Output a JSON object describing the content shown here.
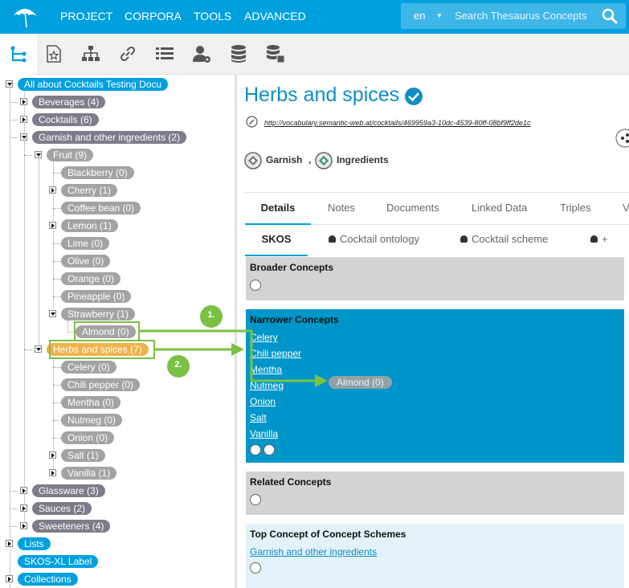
{
  "nav": {
    "menu": [
      "PROJECT",
      "CORPORA",
      "TOOLS",
      "ADVANCED"
    ],
    "lang": "en",
    "search_placeholder": "Search Thesaurus Concepts"
  },
  "toolbar": {
    "icons": [
      "hierarchy-tree-icon",
      "star-document-icon",
      "org-chart-icon",
      "link-icon",
      "list-icon",
      "user-settings-icon",
      "database-icon",
      "database-server-icon"
    ]
  },
  "tree": {
    "root": "All about Cocktails Testing Docu",
    "beverages": "Beverages (4)",
    "cocktails": "Cocktails (6)",
    "garnish": "Garnish and other ingredients (2)",
    "fruit": "Fruit (9)",
    "fruit_items": [
      "Blackberry (0)",
      "Cherry (1)",
      "Coffee bean (0)",
      "Lemon (1)",
      "Lime (0)",
      "Olive (0)",
      "Orange (0)",
      "Pineapple (0)",
      "Strawberry (1)"
    ],
    "almond": "Almond (0)",
    "herbs": "Herbs and spices (7)",
    "herb_items": [
      "Celery (0)",
      "Chili pepper (0)",
      "Mentha (0)",
      "Nutmeg (0)",
      "Onion (0)",
      "Salt (1)",
      "Vanilla (1)"
    ],
    "glassware": "Glassware (3)",
    "sauces": "Sauces (2)",
    "sweeteners": "Sweeteners (4)",
    "lists": "Lists",
    "skosxl": "SKOS-XL Label",
    "collections": "Collections"
  },
  "concept": {
    "title": "Herbs and spices",
    "uri": "http://vocabulary.semantic-web.at/cocktails/469959a3-10dc-4539-80ff-08bf9ff2de1c",
    "tag1": "Garnish",
    "tag_sep": ",",
    "tag2": "Ingredients"
  },
  "tabs": [
    "Details",
    "Notes",
    "Documents",
    "Linked Data",
    "Triples",
    "V"
  ],
  "subtabs": [
    "SKOS",
    "Cocktail ontology",
    "Cocktail scheme",
    "+"
  ],
  "sections": {
    "broader": "Broader Concepts",
    "narrower": "Narrower Concepts",
    "narrower_items": [
      "Celery",
      "Chili pepper",
      "Mentha",
      "Nutmeg",
      "Onion",
      "Salt",
      "Vanilla"
    ],
    "related": "Related Concepts",
    "top": "Top Concept of Concept Schemes",
    "top_link": "Garnish and other ingredients"
  },
  "annotations": {
    "step1": "1.",
    "step2": "2.",
    "drag_ghost": "Almond (0)"
  },
  "colors": {
    "brand": "#00a0df",
    "narrower_bg": "#0096c9",
    "grey_section": "#d3d3d3",
    "top_section": "#e2f2f8",
    "annotation_green": "#7ac143",
    "title_blue": "#0f8ec6"
  }
}
